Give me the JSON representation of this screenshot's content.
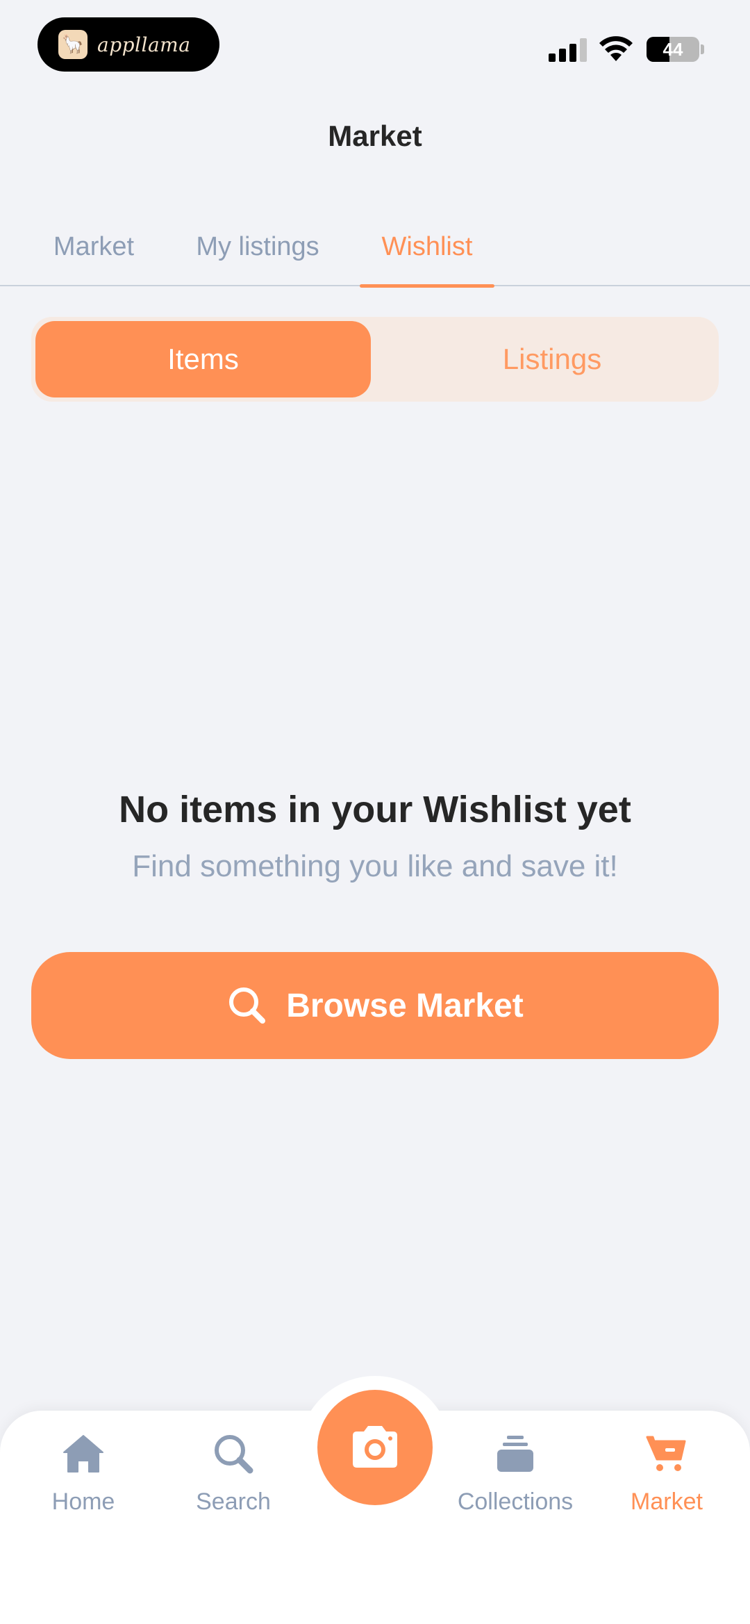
{
  "status_bar": {
    "app_name": "appllama",
    "battery_level": 44,
    "battery_text": "44"
  },
  "header": {
    "title": "Market"
  },
  "tabs": [
    {
      "label": "Market",
      "active": false
    },
    {
      "label": "My listings",
      "active": false
    },
    {
      "label": "Wishlist",
      "active": true
    }
  ],
  "segment": {
    "items_label": "Items",
    "listings_label": "Listings",
    "selected": "Items"
  },
  "empty_state": {
    "title": "No items in your Wishlist yet",
    "subtitle": "Find something you like and save it!",
    "button_label": "Browse Market",
    "button_icon": "search-icon"
  },
  "bottom_nav": {
    "items": [
      {
        "label": "Home",
        "icon": "home-icon",
        "active": false
      },
      {
        "label": "Search",
        "icon": "search-icon",
        "active": false
      },
      {
        "label": "Collections",
        "icon": "stack-icon",
        "active": false
      },
      {
        "label": "Market",
        "icon": "cart-icon",
        "active": true
      }
    ],
    "center_icon": "camera-icon"
  },
  "colors": {
    "accent": "#ff9055",
    "muted": "#8d9db5",
    "background": "#f2f3f7"
  }
}
